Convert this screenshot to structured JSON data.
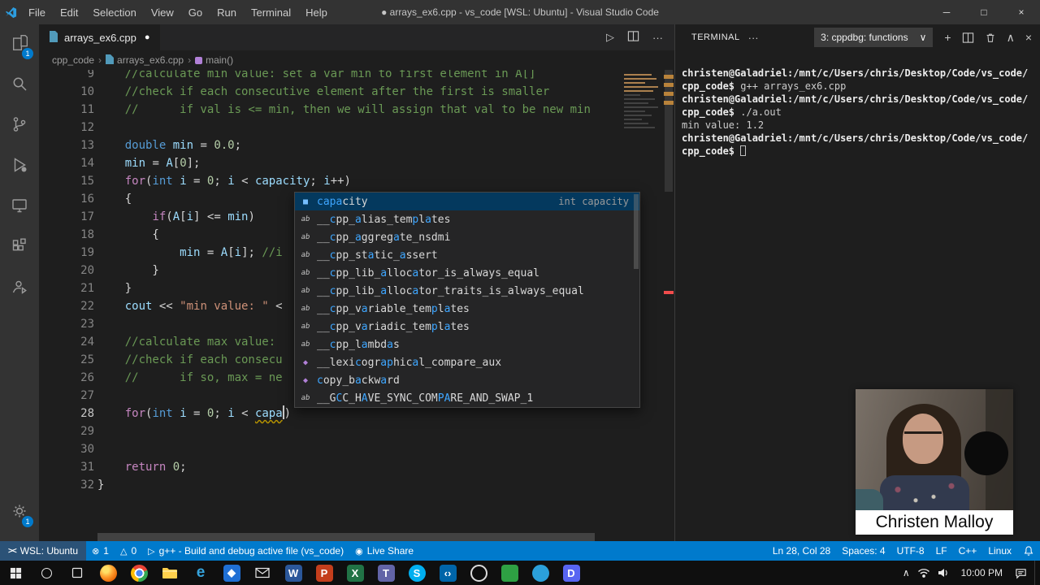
{
  "colors": {
    "accent": "#007acc",
    "remote_chip": "#2b5277",
    "editor_bg": "#1e1e1e",
    "titlebar_bg": "#333333"
  },
  "title_bar": {
    "menus": [
      "File",
      "Edit",
      "Selection",
      "View",
      "Go",
      "Run",
      "Terminal",
      "Help"
    ],
    "title": "● arrays_ex6.cpp - vs_code [WSL: Ubuntu] - Visual Studio Code"
  },
  "activity_bar": {
    "top": [
      {
        "icon": "explorer-icon",
        "badge": "1"
      },
      {
        "icon": "search-icon"
      },
      {
        "icon": "source-control-icon"
      },
      {
        "icon": "run-debug-icon"
      },
      {
        "icon": "remote-explorer-icon"
      },
      {
        "icon": "extensions-icon"
      },
      {
        "icon": "live-share-icon"
      }
    ],
    "bottom": [
      {
        "icon": "manage-icon",
        "badge": "1"
      }
    ]
  },
  "editor": {
    "tab": {
      "label": "arrays_ex6.cpp",
      "modified_dot": "●"
    },
    "actions": [
      "run-icon",
      "split-editor-icon",
      "more-actions-icon"
    ],
    "breadcrumbs": [
      {
        "label": "cpp_code"
      },
      {
        "icon": "file-icon",
        "label": "arrays_ex6.cpp"
      },
      {
        "icon": "symbol-method-icon",
        "label": "main()"
      }
    ],
    "active_line": 28,
    "lines": [
      {
        "n": 9,
        "segs": [
          [
            "    //calculate min value: set a var min to first element in A[]",
            "cm"
          ]
        ]
      },
      {
        "n": 10,
        "segs": [
          [
            "    //check if each consecutive element after the first is smaller",
            "cm"
          ]
        ]
      },
      {
        "n": 11,
        "segs": [
          [
            "    //      if val is <= min, then we will assign that val to be new min",
            "cm"
          ]
        ]
      },
      {
        "n": 12,
        "segs": []
      },
      {
        "n": 13,
        "segs": [
          [
            "    ",
            "pl"
          ],
          [
            "double",
            "kw"
          ],
          [
            " ",
            "pl"
          ],
          [
            "min",
            "vr"
          ],
          [
            " = ",
            "pl"
          ],
          [
            "0.0",
            "nm"
          ],
          [
            ";",
            "pl"
          ]
        ]
      },
      {
        "n": 14,
        "segs": [
          [
            "    ",
            "pl"
          ],
          [
            "min",
            "vr"
          ],
          [
            " = ",
            "pl"
          ],
          [
            "A",
            "vr"
          ],
          [
            "[",
            "pl"
          ],
          [
            "0",
            "nm"
          ],
          [
            "];",
            "pl"
          ]
        ]
      },
      {
        "n": 15,
        "segs": [
          [
            "    ",
            "pl"
          ],
          [
            "for",
            "ct"
          ],
          [
            "(",
            "pl"
          ],
          [
            "int",
            "kw"
          ],
          [
            " ",
            "pl"
          ],
          [
            "i",
            "vr"
          ],
          [
            " = ",
            "pl"
          ],
          [
            "0",
            "nm"
          ],
          [
            "; ",
            "pl"
          ],
          [
            "i",
            "vr"
          ],
          [
            " < ",
            "pl"
          ],
          [
            "capacity",
            "vr"
          ],
          [
            "; ",
            "pl"
          ],
          [
            "i",
            "vr"
          ],
          [
            "++)",
            "pl"
          ]
        ]
      },
      {
        "n": 16,
        "segs": [
          [
            "    {",
            "pl"
          ]
        ]
      },
      {
        "n": 17,
        "segs": [
          [
            "        ",
            "pl"
          ],
          [
            "if",
            "ct"
          ],
          [
            "(",
            "pl"
          ],
          [
            "A",
            "vr"
          ],
          [
            "[",
            "pl"
          ],
          [
            "i",
            "vr"
          ],
          [
            "]",
            "pl"
          ],
          [
            " <= ",
            "pl"
          ],
          [
            "min",
            "vr"
          ],
          [
            ")",
            "pl"
          ]
        ]
      },
      {
        "n": 18,
        "segs": [
          [
            "        {",
            "pl"
          ]
        ]
      },
      {
        "n": 19,
        "segs": [
          [
            "            ",
            "pl"
          ],
          [
            "min",
            "vr"
          ],
          [
            " = ",
            "pl"
          ],
          [
            "A",
            "vr"
          ],
          [
            "[",
            "pl"
          ],
          [
            "i",
            "vr"
          ],
          [
            "];",
            "pl"
          ],
          [
            " ",
            "pl"
          ],
          [
            "//i",
            "cm"
          ]
        ]
      },
      {
        "n": 20,
        "segs": [
          [
            "        }",
            "pl"
          ]
        ]
      },
      {
        "n": 21,
        "segs": [
          [
            "    }",
            "pl"
          ]
        ]
      },
      {
        "n": 22,
        "segs": [
          [
            "    ",
            "pl"
          ],
          [
            "cout",
            "vr"
          ],
          [
            " << ",
            "pl"
          ],
          [
            "\"min value: \"",
            "st"
          ],
          [
            " <",
            "pl"
          ]
        ]
      },
      {
        "n": 23,
        "segs": []
      },
      {
        "n": 24,
        "segs": [
          [
            "    ",
            "pl"
          ],
          [
            "//calculate max value:",
            "cm"
          ]
        ]
      },
      {
        "n": 25,
        "segs": [
          [
            "    ",
            "pl"
          ],
          [
            "//check if each consecu",
            "cm"
          ]
        ]
      },
      {
        "n": 26,
        "segs": [
          [
            "    ",
            "pl"
          ],
          [
            "//      if so, max = ne",
            "cm"
          ]
        ]
      },
      {
        "n": 27,
        "segs": []
      },
      {
        "n": 28,
        "segs": [
          [
            "    ",
            "pl"
          ],
          [
            "for",
            "ct"
          ],
          [
            "(",
            "pl"
          ],
          [
            "int",
            "kw"
          ],
          [
            " ",
            "pl"
          ],
          [
            "i",
            "vr"
          ],
          [
            " = ",
            "pl"
          ],
          [
            "0",
            "nm"
          ],
          [
            "; ",
            "pl"
          ],
          [
            "i",
            "vr"
          ],
          [
            " < ",
            "pl"
          ],
          [
            "capa",
            "vr sqw"
          ],
          [
            "",
            "cur"
          ],
          [
            ")",
            "pl"
          ]
        ]
      },
      {
        "n": 29,
        "segs": []
      },
      {
        "n": 30,
        "segs": []
      },
      {
        "n": 31,
        "segs": [
          [
            "    ",
            "pl"
          ],
          [
            "return",
            "ct"
          ],
          [
            " ",
            "pl"
          ],
          [
            "0",
            "nm"
          ],
          [
            ";",
            "pl"
          ]
        ]
      },
      {
        "n": 32,
        "segs": [
          [
            "}",
            "pl"
          ]
        ]
      }
    ]
  },
  "suggest": {
    "items": [
      {
        "kind": "field",
        "label": "capacity",
        "matches": [
          0,
          1,
          2,
          3
        ],
        "detail": "int capacity",
        "selected": true
      },
      {
        "kind": "word",
        "label": "__cpp_alias_templates",
        "matches": [
          2,
          6,
          15,
          17
        ]
      },
      {
        "kind": "word",
        "label": "__cpp_aggregate_nsdmi",
        "matches": [
          2,
          6,
          12
        ]
      },
      {
        "kind": "word",
        "label": "__cpp_static_assert",
        "matches": [
          2,
          8,
          13
        ]
      },
      {
        "kind": "word",
        "label": "__cpp_lib_allocator_is_always_equal",
        "matches": [
          2,
          10,
          15
        ]
      },
      {
        "kind": "word",
        "label": "__cpp_lib_allocator_traits_is_always_equal",
        "matches": [
          2,
          10,
          15
        ]
      },
      {
        "kind": "word",
        "label": "__cpp_variable_templates",
        "matches": [
          2,
          7,
          18,
          20
        ]
      },
      {
        "kind": "word",
        "label": "__cpp_variadic_templates",
        "matches": [
          2,
          7,
          18,
          20
        ]
      },
      {
        "kind": "word",
        "label": "__cpp_lambdas",
        "matches": [
          2,
          7,
          11
        ]
      },
      {
        "kind": "method",
        "label": "__lexicographical_compare_aux",
        "matches": [
          6,
          10,
          11,
          15
        ]
      },
      {
        "kind": "method",
        "label": "copy_backward",
        "matches": [
          0,
          6,
          10
        ]
      },
      {
        "kind": "word",
        "label": "__GCC_HAVE_SYNC_COMPARE_AND_SWAP_1",
        "matches": [
          3,
          7,
          19,
          20
        ]
      }
    ]
  },
  "terminal": {
    "title": "TERMINAL",
    "overflow": "···",
    "dropdown": "3: cppdbg: functions",
    "actions": [
      "new-terminal-icon",
      "split-terminal-icon",
      "kill-terminal-icon",
      "maximize-panel-icon",
      "close-panel-icon"
    ],
    "lines": [
      {
        "segs": [
          [
            "christen@Galadriel:/mnt/c/Users/chris/Desktop/Code/vs_code/",
            "b"
          ]
        ]
      },
      {
        "segs": [
          [
            "cpp_code$",
            "b"
          ],
          [
            " g++ arrays_ex6.cpp",
            ""
          ]
        ]
      },
      {
        "segs": [
          [
            "christen@Galadriel:/mnt/c/Users/chris/Desktop/Code/vs_code/",
            "b"
          ]
        ]
      },
      {
        "segs": [
          [
            "cpp_code$",
            "b"
          ],
          [
            " ./a.out",
            ""
          ]
        ]
      },
      {
        "segs": [
          [
            "min value: 1.2",
            ""
          ]
        ]
      },
      {
        "segs": [
          [
            "christen@Galadriel:/mnt/c/Users/chris/Desktop/Code/vs_code/",
            "b"
          ]
        ]
      },
      {
        "segs": [
          [
            "cpp_code$ ",
            "b"
          ],
          [
            "",
            "cursor"
          ]
        ]
      }
    ]
  },
  "status_bar": {
    "left": [
      {
        "name": "remote-indicator",
        "icon": "remote-icon",
        "label": "WSL: Ubuntu",
        "chip": true
      },
      {
        "name": "error-count",
        "icon": "error-icon",
        "label": "1"
      },
      {
        "name": "warning-count",
        "icon": "warning-icon",
        "label": "0"
      },
      {
        "name": "build-task",
        "icon": "play-icon",
        "label": "g++ - Build and debug active file (vs_code)"
      },
      {
        "name": "live-share",
        "icon": "live-share-status-icon",
        "label": "Live Share"
      }
    ],
    "right": [
      {
        "name": "line-col",
        "label": "Ln 28, Col 28"
      },
      {
        "name": "indentation",
        "label": "Spaces: 4"
      },
      {
        "name": "encoding",
        "label": "UTF-8"
      },
      {
        "name": "eol",
        "label": "LF"
      },
      {
        "name": "language-mode",
        "label": "C++"
      },
      {
        "name": "remote-os",
        "label": "Linux"
      },
      {
        "name": "notifications-bell",
        "icon": "bell-icon"
      }
    ]
  },
  "taskbar": {
    "apps": [
      {
        "name": "firefox",
        "shape": "firefox"
      },
      {
        "name": "chrome",
        "shape": "chrome"
      },
      {
        "name": "file-explorer",
        "shape": "folder"
      },
      {
        "name": "edge",
        "shape": "text",
        "fg": "#35a3dc",
        "glyph": "e"
      },
      {
        "name": "photos",
        "shape": "square",
        "color": "#1f6fd4",
        "glyph": "◆"
      },
      {
        "name": "mail",
        "shape": "envelope"
      },
      {
        "name": "word",
        "shape": "square",
        "color": "#2b579a",
        "glyph": "W"
      },
      {
        "name": "powerpoint",
        "shape": "square",
        "color": "#c43e1c",
        "glyph": "P"
      },
      {
        "name": "excel",
        "shape": "square",
        "color": "#217346",
        "glyph": "X"
      },
      {
        "name": "teams",
        "shape": "square",
        "color": "#6264a7",
        "glyph": "T"
      },
      {
        "name": "skype",
        "shape": "circle",
        "color": "#00aff0",
        "glyph": "S"
      },
      {
        "name": "vscode",
        "shape": "square",
        "color": "#0065a9",
        "glyph": "‹›"
      },
      {
        "name": "obs",
        "shape": "ring"
      },
      {
        "name": "green-app",
        "shape": "square",
        "color": "#2ea043"
      },
      {
        "name": "blue-app",
        "shape": "circle",
        "color": "#2ba0da"
      },
      {
        "name": "discord",
        "shape": "square",
        "color": "#5865f2",
        "glyph": "D"
      }
    ],
    "tray": {
      "chevron": "∧",
      "time": "10:00 PM"
    }
  },
  "webcam": {
    "name": "Christen Malloy"
  }
}
